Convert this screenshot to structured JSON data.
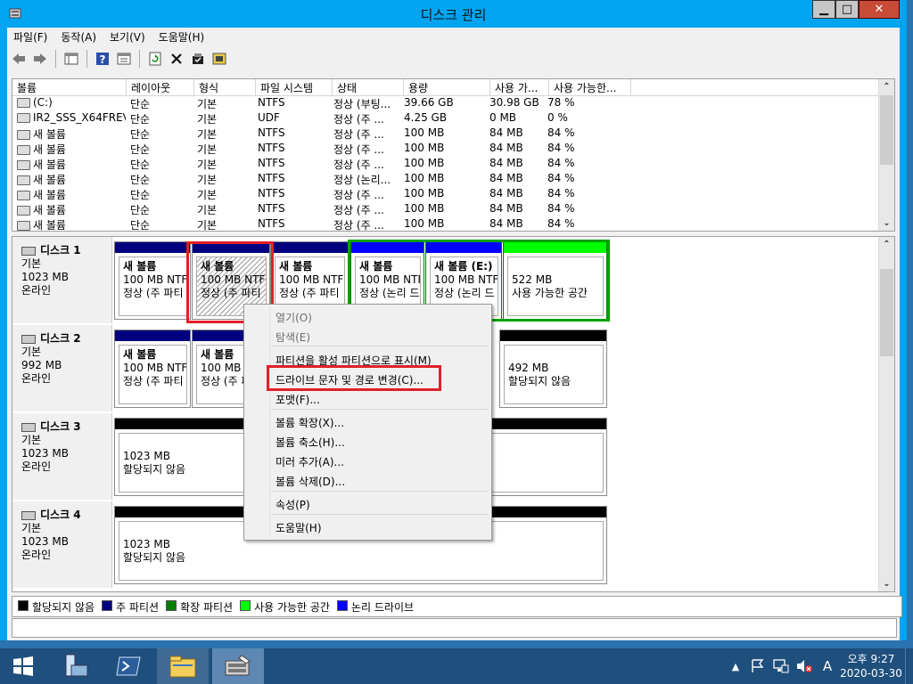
{
  "window": {
    "title": "디스크 관리",
    "min_label": "▁",
    "max_label": "□",
    "close_label": "✕"
  },
  "menu": [
    "파일(F)",
    "동작(A)",
    "보기(V)",
    "도움말(H)"
  ],
  "toolbar_icons": [
    "back-icon",
    "forward-icon",
    "console-tree-icon",
    "help-icon",
    "properties-icon",
    "refresh-icon",
    "delete-icon",
    "check-icon",
    "export-icon"
  ],
  "volume_table": {
    "headers": [
      "볼륨",
      "레이아웃",
      "형식",
      "파일 시스템",
      "상태",
      "용량",
      "사용 가...",
      "사용 가능한..."
    ],
    "rows": [
      [
        "(C:)",
        "단순",
        "기본",
        "NTFS",
        "정상 (부팅...",
        "39.66 GB",
        "30.98 GB",
        "78 %"
      ],
      [
        "IR2_SSS_X64FREV...",
        "단순",
        "기본",
        "UDF",
        "정상 (주 ...",
        "4.25 GB",
        "0 MB",
        "0 %"
      ],
      [
        "새 볼륨",
        "단순",
        "기본",
        "NTFS",
        "정상 (주 ...",
        "100 MB",
        "84 MB",
        "84 %"
      ],
      [
        "새 볼륨",
        "단순",
        "기본",
        "NTFS",
        "정상 (주 ...",
        "100 MB",
        "84 MB",
        "84 %"
      ],
      [
        "새 볼륨",
        "단순",
        "기본",
        "NTFS",
        "정상 (주 ...",
        "100 MB",
        "84 MB",
        "84 %"
      ],
      [
        "새 볼륨",
        "단순",
        "기본",
        "NTFS",
        "정상 (논리...",
        "100 MB",
        "84 MB",
        "84 %"
      ],
      [
        "새 볼륨",
        "단순",
        "기본",
        "NTFS",
        "정상 (주 ...",
        "100 MB",
        "84 MB",
        "84 %"
      ],
      [
        "새 볼륨",
        "단순",
        "기본",
        "NTFS",
        "정상 (주 ...",
        "100 MB",
        "84 MB",
        "84 %"
      ],
      [
        "새 볼륨",
        "단순",
        "기본",
        "NTFS",
        "정상 (주 ...",
        "100 MB",
        "84 MB",
        "84 %"
      ]
    ]
  },
  "disks": [
    {
      "name": "디스크 1",
      "type": "기본",
      "size": "1023 MB",
      "status": "온라인",
      "partitions": [
        {
          "title": "새 볼륨",
          "line1": "100 MB NTFS",
          "line2": "정상 (주 파티",
          "bar": "#00007f"
        },
        {
          "title": "새 볼륨",
          "line1": "100 MB NTFS",
          "line2": "정상 (주 파티",
          "bar": "#00007f"
        },
        {
          "title": "새 볼륨",
          "line1": "100 MB NTFS",
          "line2": "정상 (주 파티",
          "bar": "#00007f"
        },
        {
          "title": "새 볼륨",
          "line1": "100 MB NTFS",
          "line2": "정상 (논리 드",
          "bar": "#0000ff"
        },
        {
          "title": "새 볼륨  (E:)",
          "line1": "100 MB NTFS",
          "line2": "정상 (논리 드",
          "bar": "#0000ff"
        },
        {
          "title": "",
          "line1": "522 MB",
          "line2": "사용 가능한 공간",
          "bar": "#00ff00"
        }
      ]
    },
    {
      "name": "디스크 2",
      "type": "기본",
      "size": "992 MB",
      "status": "온라인",
      "partitions": [
        {
          "title": "새 볼륨",
          "line1": "100 MB NTFS",
          "line2": "정상 (주 파티",
          "bar": "#00007f"
        },
        {
          "title": "새 볼륨",
          "line1": "100 MB NTFS",
          "line2": "정상 (주 파티",
          "bar": "#00007f"
        },
        {
          "title": "",
          "line1": "492 MB",
          "line2": "할당되지 않음",
          "bar": "#000000"
        }
      ]
    },
    {
      "name": "디스크 3",
      "type": "기본",
      "size": "1023 MB",
      "status": "온라인",
      "partitions": [
        {
          "title": "",
          "line1": "1023 MB",
          "line2": "할당되지 않음",
          "bar": "#000000"
        }
      ]
    },
    {
      "name": "디스크 4",
      "type": "기본",
      "size": "1023 MB",
      "status": "온라인",
      "partitions": [
        {
          "title": "",
          "line1": "1023 MB",
          "line2": "할당되지 않음",
          "bar": "#000000"
        }
      ]
    }
  ],
  "legend": [
    {
      "label": "할당되지 않음",
      "color": "#000000"
    },
    {
      "label": "주 파티션",
      "color": "#00007f"
    },
    {
      "label": "확장 파티션",
      "color": "#007f00"
    },
    {
      "label": "사용 가능한 공간",
      "color": "#00ff00"
    },
    {
      "label": "논리 드라이브",
      "color": "#0000ff"
    }
  ],
  "context_menu": {
    "items": [
      {
        "label": "열기(O)",
        "disabled": true
      },
      {
        "label": "탐색(E)",
        "disabled": true
      },
      {
        "label": "파티션을 활성 파티션으로 표시(M)",
        "disabled": false
      },
      {
        "label": "드라이브 문자 및 경로 변경(C)...",
        "disabled": false
      },
      {
        "label": "포맷(F)...",
        "disabled": false
      },
      {
        "label": "볼륨 확장(X)...",
        "disabled": false
      },
      {
        "label": "볼륨 축소(H)...",
        "disabled": false
      },
      {
        "label": "미러 추가(A)...",
        "disabled": false
      },
      {
        "label": "볼륨 삭제(D)...",
        "disabled": false
      },
      {
        "label": "속성(P)",
        "disabled": false
      },
      {
        "label": "도움말(H)",
        "disabled": false
      }
    ]
  },
  "taskbar": {
    "clock_time": "오후 9:27",
    "clock_date": "2020-03-30",
    "ime_label": "A"
  }
}
